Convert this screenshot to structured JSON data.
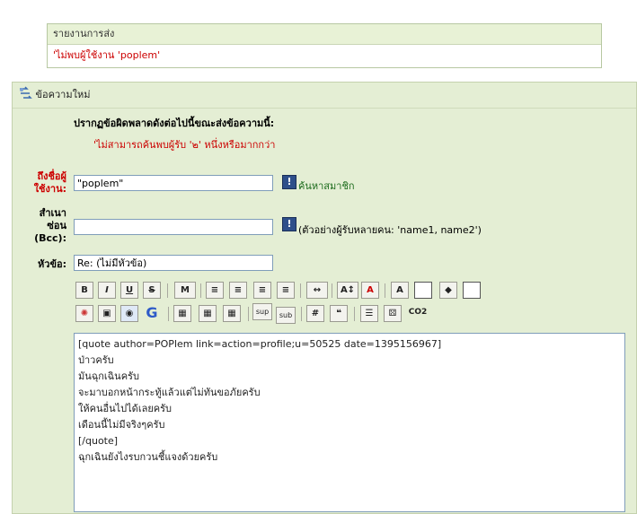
{
  "report": {
    "title": "รายงานการส่ง",
    "error": "'ไม่พบผู้ใช้งาน 'poplem'"
  },
  "compose": {
    "header_title": "ข้อความใหม่",
    "error_heading": "ปรากฏข้อผิดพลาดดังต่อไปนี้ขณะส่งข้อความนี้:",
    "error_detail": "'ไม่สามารถค้นพบผู้รับ '๒' หนึ่งหรือมากกว่า",
    "to": {
      "label_line1": "ถึงชื่อผู้",
      "label_line2": "ใช้งาน:",
      "value": "\"poplem\"",
      "search_link": "ค้นหาสมาชิก"
    },
    "bcc": {
      "label_line1": "สำเนา",
      "label_line2": "ซ่อน",
      "label_line3": "(Bcc):",
      "value": "",
      "hint": "(ตัวอย่างผู้รับหลายคน: 'name1, name2')"
    },
    "subject": {
      "label": "หัวข้อ:",
      "value": "Re: (ไม่มีหัวข้อ)"
    },
    "toolbar": {
      "bold": "B",
      "italic": "I",
      "underline": "U",
      "strike": "S",
      "marquee": "M",
      "sup": "sup",
      "sub": "sub",
      "hash": "#",
      "co2": "CO2"
    },
    "body_lines": [
      "[quote author=POPlem link=action=profile;u=50525 date=1395156967]",
      "ป่าวครับ",
      "มันฉุกเฉินครับ",
      "จะมาบอกหน้ากระทู้แล้วแต่ไม่ทันขอภัยครับ",
      "ให้คนอื่นไปได้เลยครับ",
      "เดือนนี้ไม่มีจริงๆครับ",
      "[/quote]",
      "ฉุกเฉินยังไงรบกวนชี้แจงด้วยครับ"
    ]
  }
}
